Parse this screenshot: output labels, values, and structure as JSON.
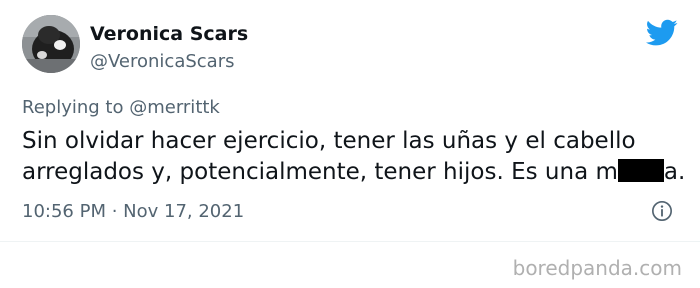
{
  "tweet": {
    "author": {
      "display_name": "Veronica Scars",
      "handle": "@VeronicaScars"
    },
    "reply": {
      "prefix": "Replying to",
      "mention": "@merrittk"
    },
    "text_lines": [
      "Sin olvidar hacer ejercicio, tener las uñas y el cabello",
      "arreglados y, potencialmente, tener hijos. Es una m"
    ],
    "text_after_redaction": "a.",
    "timestamp": "10:56 PM · Nov 17, 2021"
  },
  "icons": {
    "logo": "twitter-bird-icon",
    "info": "info-icon"
  },
  "colors": {
    "twitter_blue": "#1d9bf0",
    "secondary_text": "#536471",
    "redaction": "#000000"
  },
  "watermark": {
    "text": "boredpanda.com"
  }
}
